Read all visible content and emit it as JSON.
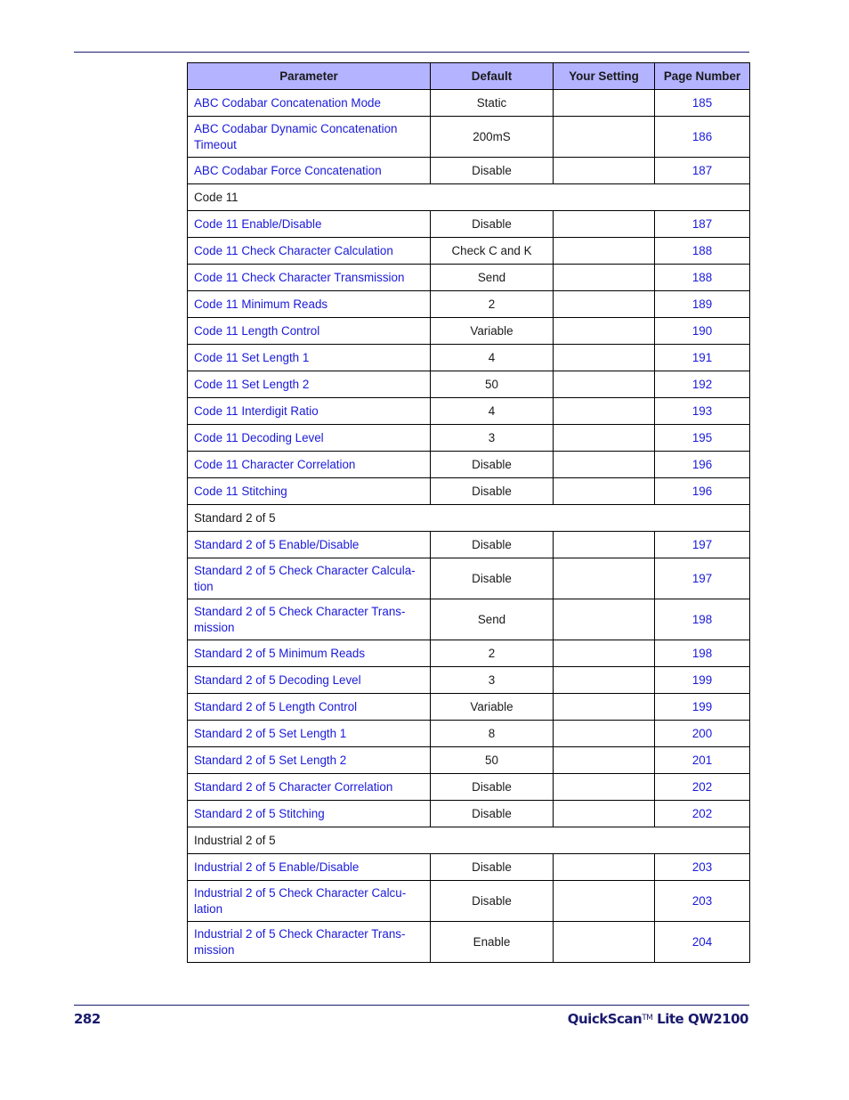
{
  "table": {
    "headers": [
      "Parameter",
      "Default",
      "Your Setting",
      "Page Number"
    ],
    "rows": [
      {
        "type": "item",
        "parameter": "ABC Codabar Concatenation Mode",
        "default": "Static",
        "setting": "",
        "page": "185"
      },
      {
        "type": "item2",
        "parameter": "ABC Codabar Dynamic Concatenation Timeout",
        "default": "200mS",
        "setting": "",
        "page": "186"
      },
      {
        "type": "item",
        "parameter": "ABC Codabar Force Concatenation",
        "default": "Disable",
        "setting": "",
        "page": "187"
      },
      {
        "type": "section",
        "parameter": "Code 11"
      },
      {
        "type": "item",
        "parameter": "Code 11 Enable/Disable",
        "default": "Disable",
        "setting": "",
        "page": "187"
      },
      {
        "type": "item",
        "parameter": "Code 11 Check Character Calculation",
        "default": "Check C and K",
        "setting": "",
        "page": "188"
      },
      {
        "type": "item",
        "parameter": "Code 11 Check Character Transmission",
        "default": "Send",
        "setting": "",
        "page": "188"
      },
      {
        "type": "item",
        "parameter": "Code 11 Minimum Reads",
        "default": "2",
        "setting": "",
        "page": "189"
      },
      {
        "type": "item",
        "parameter": "Code 11 Length Control",
        "default": "Variable",
        "setting": "",
        "page": "190"
      },
      {
        "type": "item",
        "parameter": "Code 11 Set Length 1",
        "default": "4",
        "setting": "",
        "page": "191"
      },
      {
        "type": "item",
        "parameter": "Code 11 Set Length 2",
        "default": "50",
        "setting": "",
        "page": "192"
      },
      {
        "type": "item",
        "parameter": "Code 11 Interdigit Ratio",
        "default": "4",
        "setting": "",
        "page": "193"
      },
      {
        "type": "item",
        "parameter": "Code 11 Decoding Level",
        "default": "3",
        "setting": "",
        "page": "195"
      },
      {
        "type": "item",
        "parameter": "Code 11 Character Correlation",
        "default": "Disable",
        "setting": "",
        "page": "196"
      },
      {
        "type": "item",
        "parameter": "Code 11 Stitching",
        "default": "Disable",
        "setting": "",
        "page": "196"
      },
      {
        "type": "section",
        "parameter": "Standard 2 of 5"
      },
      {
        "type": "item",
        "parameter": "Standard 2 of 5 Enable/Disable",
        "default": "Disable",
        "setting": "",
        "page": "197"
      },
      {
        "type": "item2",
        "parameter": "Standard 2 of 5 Check Character Calcula-tion",
        "default": "Disable",
        "setting": "",
        "page": "197"
      },
      {
        "type": "item2",
        "parameter": "Standard 2 of 5 Check Character Trans-mission",
        "default": "Send",
        "setting": "",
        "page": "198"
      },
      {
        "type": "item",
        "parameter": "Standard 2 of 5 Minimum Reads",
        "default": "2",
        "setting": "",
        "page": "198"
      },
      {
        "type": "item",
        "parameter": "Standard 2 of 5 Decoding Level",
        "default": "3",
        "setting": "",
        "page": "199"
      },
      {
        "type": "item",
        "parameter": "Standard 2 of 5 Length Control",
        "default": "Variable",
        "setting": "",
        "page": "199"
      },
      {
        "type": "item",
        "parameter": "Standard 2 of 5 Set Length 1",
        "default": "8",
        "setting": "",
        "page": "200"
      },
      {
        "type": "item",
        "parameter": "Standard 2 of 5 Set Length 2",
        "default": "50",
        "setting": "",
        "page": "201"
      },
      {
        "type": "item",
        "parameter": "Standard 2 of 5 Character Correlation",
        "default": "Disable",
        "setting": "",
        "page": "202"
      },
      {
        "type": "item",
        "parameter": "Standard 2 of 5 Stitching",
        "default": "Disable",
        "setting": "",
        "page": "202"
      },
      {
        "type": "section",
        "parameter": "Industrial 2 of 5"
      },
      {
        "type": "item",
        "parameter": "Industrial 2 of 5 Enable/Disable",
        "default": "Disable",
        "setting": "",
        "page": "203"
      },
      {
        "type": "item2",
        "parameter": "Industrial 2 of 5 Check Character Calcu-lation",
        "default": "Disable",
        "setting": "",
        "page": "203"
      },
      {
        "type": "item2",
        "parameter": "Industrial 2 of 5 Check Character Trans-mission",
        "default": "Enable",
        "setting": "",
        "page": "204"
      }
    ]
  },
  "footer": {
    "page_number": "282",
    "product": "QuickScan",
    "trademark": "TM",
    "model": " Lite QW2100"
  },
  "colors": {
    "header_bg": "#b3b3ff",
    "link": "#1a1ad9",
    "footer": "#1a1a6e"
  }
}
